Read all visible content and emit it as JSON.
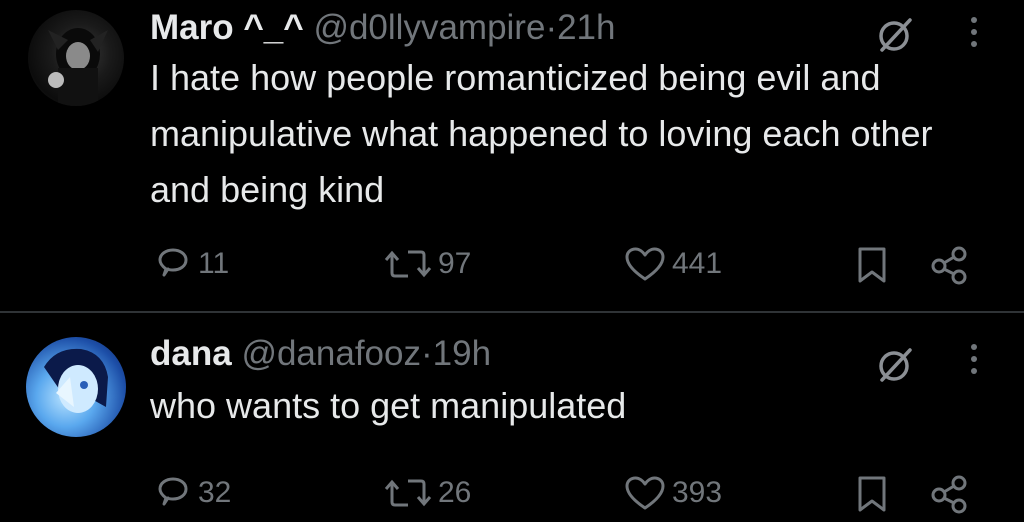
{
  "tweets": [
    {
      "name": "Maro ^_^",
      "handle": "@d0llyvampire",
      "separator": "·",
      "time": "21h",
      "text": "I hate how people romanticized being evil and manipulative what happened to loving each other and being kind",
      "replies": "11",
      "retweets": "97",
      "likes": "441"
    },
    {
      "name": "dana",
      "handle": "@danafooz",
      "separator": "·",
      "time": "19h",
      "text": "who wants to get manipulated",
      "replies": "32",
      "retweets": "26",
      "likes": "393"
    }
  ],
  "icons": {
    "grok": "grok-icon",
    "more": "more-icon",
    "reply": "reply-icon",
    "retweet": "retweet-icon",
    "like": "heart-icon",
    "bookmark": "bookmark-icon",
    "share": "share-icon"
  },
  "colors": {
    "background": "#000000",
    "primary_text": "#e7e9ea",
    "secondary_text": "#71767b",
    "divider": "#2f3336"
  }
}
